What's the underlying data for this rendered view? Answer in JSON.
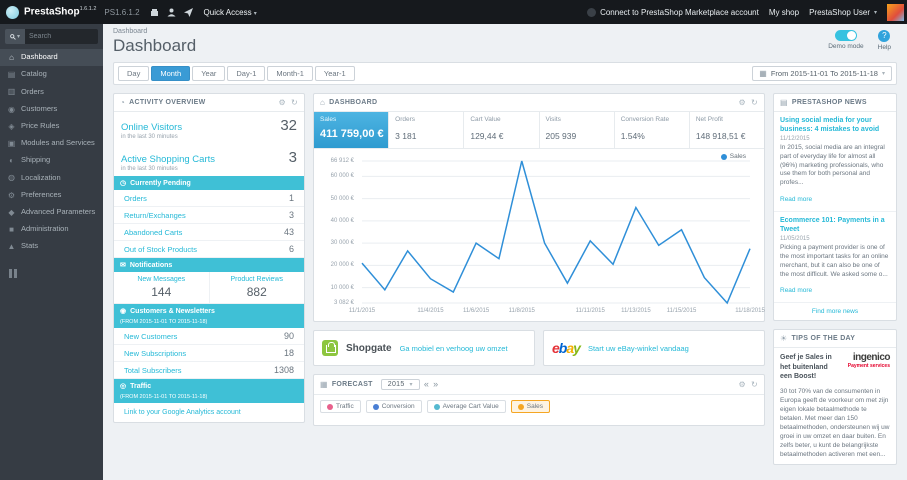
{
  "topbar": {
    "brand": "PrestaShop",
    "brand_sup": "1.6.1.2",
    "version": "PS1.6.1.2",
    "quick_access": "Quick Access",
    "marketplace": "Connect to PrestaShop Marketplace account",
    "my_shop": "My shop",
    "user": "PrestaShop User"
  },
  "sidebar": {
    "search_placeholder": "Search",
    "items": [
      {
        "label": "Dashboard",
        "icon": "⌂"
      },
      {
        "label": "Catalog",
        "icon": "▤"
      },
      {
        "label": "Orders",
        "icon": "▥"
      },
      {
        "label": "Customers",
        "icon": "◉"
      },
      {
        "label": "Price Rules",
        "icon": "◈"
      },
      {
        "label": "Modules and Services",
        "icon": "▣"
      },
      {
        "label": "Shipping",
        "icon": "◐"
      },
      {
        "label": "Localization",
        "icon": "◍"
      },
      {
        "label": "Preferences",
        "icon": "⚙"
      },
      {
        "label": "Advanced Parameters",
        "icon": "◆"
      },
      {
        "label": "Administration",
        "icon": "■"
      },
      {
        "label": "Stats",
        "icon": "▲"
      }
    ]
  },
  "header": {
    "breadcrumb": "Dashboard",
    "title": "Dashboard",
    "demo_mode_label": "Demo mode",
    "help_label": "Help"
  },
  "filters": {
    "buttons": [
      "Day",
      "Month",
      "Year",
      "Day-1",
      "Month-1",
      "Year-1"
    ],
    "active": "Month",
    "date_range": "From 2015-11-01 To 2015-11-18"
  },
  "activity": {
    "title": "ACTIVITY OVERVIEW",
    "online_visitors": {
      "label": "Online Visitors",
      "value": "32",
      "sub": "in the last 30 minutes"
    },
    "active_carts": {
      "label": "Active Shopping Carts",
      "value": "3",
      "sub": "in the last 30 minutes"
    },
    "pending": {
      "title": "Currently Pending",
      "rows": [
        {
          "label": "Orders",
          "value": "1"
        },
        {
          "label": "Return/Exchanges",
          "value": "3"
        },
        {
          "label": "Abandoned Carts",
          "value": "43"
        },
        {
          "label": "Out of Stock Products",
          "value": "6"
        }
      ]
    },
    "notifications": {
      "title": "Notifications",
      "cols": [
        {
          "label": "New Messages",
          "value": "144"
        },
        {
          "label": "Product Reviews",
          "value": "882"
        }
      ]
    },
    "customers": {
      "title": "Customers & Newsletters",
      "subtitle": "(FROM 2015-11-01 TO 2015-11-18)",
      "rows": [
        {
          "label": "New Customers",
          "value": "90"
        },
        {
          "label": "New Subscriptions",
          "value": "18"
        },
        {
          "label": "Total Subscribers",
          "value": "1308"
        }
      ]
    },
    "traffic": {
      "title": "Traffic",
      "subtitle": "(FROM 2015-11-01 TO 2015-11-18)",
      "link": "Link to your Google Analytics account"
    }
  },
  "dashboard_panel": {
    "title": "DASHBOARD",
    "kpis": [
      {
        "label": "Sales",
        "value": "411 759,00 €"
      },
      {
        "label": "Orders",
        "value": "3 181"
      },
      {
        "label": "Cart Value",
        "value": "129,44 €"
      },
      {
        "label": "Visits",
        "value": "205 939"
      },
      {
        "label": "Conversion Rate",
        "value": "1.54%"
      },
      {
        "label": "Net Profit",
        "value": "148 918,51 €"
      }
    ]
  },
  "chart_data": {
    "type": "line",
    "title": "Sales",
    "ylim": [
      3082,
      66912
    ],
    "grid": true,
    "legend_position": "top-right",
    "series": [
      {
        "name": "Sales",
        "color": "#2f8fd8",
        "values": [
          21000,
          9000,
          26500,
          14000,
          8000,
          30000,
          23000,
          66912,
          30000,
          12000,
          31000,
          20500,
          46000,
          29000,
          36000,
          14500,
          3082,
          27500
        ]
      }
    ],
    "y_ticks": [
      {
        "v": 66912,
        "label": "66 912 €"
      },
      {
        "v": 60000,
        "label": "60 000 €"
      },
      {
        "v": 50000,
        "label": "50 000 €"
      },
      {
        "v": 40000,
        "label": "40 000 €"
      },
      {
        "v": 30000,
        "label": "30 000 €"
      },
      {
        "v": 20000,
        "label": "20 000 €"
      },
      {
        "v": 10000,
        "label": "10 000 €"
      },
      {
        "v": 3082,
        "label": "3 082 €"
      }
    ],
    "x_ticks": [
      {
        "i": 0,
        "label": "11/1/2015"
      },
      {
        "i": 3,
        "label": "11/4/2015"
      },
      {
        "i": 5,
        "label": "11/6/2015"
      },
      {
        "i": 7,
        "label": "11/8/2015"
      },
      {
        "i": 10,
        "label": "11/11/2015"
      },
      {
        "i": 12,
        "label": "11/13/2015"
      },
      {
        "i": 14,
        "label": "11/15/2015"
      },
      {
        "i": 17,
        "label": "11/18/2015"
      }
    ],
    "legend": [
      "Sales"
    ]
  },
  "promos": [
    {
      "name": "Shopgate",
      "link": "Ga mobiel en verhoog uw omzet"
    },
    {
      "name": "ebay",
      "link": "Start uw eBay-winkel vandaag"
    }
  ],
  "forecast": {
    "title": "FORECAST",
    "year": "2015",
    "legend": [
      {
        "label": "Traffic",
        "color": "#e8618c"
      },
      {
        "label": "Conversion",
        "color": "#4a7fd4"
      },
      {
        "label": "Average Cart Value",
        "color": "#55b9d0"
      },
      {
        "label": "Sales",
        "color": "#f5a623"
      }
    ]
  },
  "news": {
    "title": "PRESTASHOP NEWS",
    "articles": [
      {
        "title": "Using social media for your business: 4 mistakes to avoid",
        "date": "11/12/2015",
        "excerpt": "In 2015, social media are an integral part of everyday life for almost all (96%) marketing professionals, who use them for both personal and profes...",
        "read_more": "Read more"
      },
      {
        "title": "Ecommerce 101: Payments in a Tweet",
        "date": "11/05/2015",
        "excerpt": "Picking a payment provider is one of the most important tasks for an online merchant, but it can also be one of the most difficult. We asked some o...",
        "read_more": "Read more"
      }
    ],
    "footer_link": "Find more news"
  },
  "tips": {
    "title": "TIPS OF THE DAY",
    "heading": "Geef je Sales in het buitenland een Boost!",
    "brand": "ingenico",
    "brand_sub": "Payment services",
    "body": "30 tot 70% van de consumenten in Europa geeft de voorkeur om met zijn eigen lokale betaalmethode te betalen. Met meer dan 150 betaalmethoden, ondersteunen wij uw groei in uw omzet en daar buiten. En zelfs beter, u kunt de belangrijkste betaalmethoden activeren met een..."
  }
}
